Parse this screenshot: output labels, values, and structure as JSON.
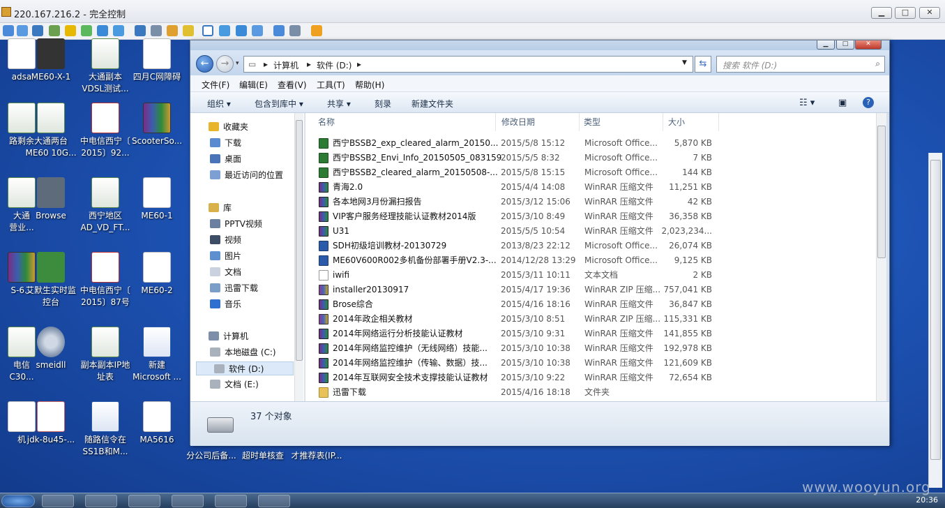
{
  "remote": {
    "title": "220.167.216.2 - 完全控制",
    "min": "▁",
    "max": "□",
    "close": "✕"
  },
  "desktop_icons": [
    {
      "label": "adsa",
      "kind": "file"
    },
    {
      "label": "ME60-X-1",
      "kind": "video"
    },
    {
      "label": "大通副本\nVDSL测试...",
      "kind": "xls"
    },
    {
      "label": "四月C网障碍",
      "kind": "file"
    },
    {
      "label": "路剩余",
      "kind": "xls"
    },
    {
      "label": "大通两台\nME60 10G...",
      "kind": "xls"
    },
    {
      "label": "中电信西宁〔\n2015〕92...",
      "kind": "pdf"
    },
    {
      "label": "ScooterSo...",
      "kind": "rar"
    },
    {
      "label": "大通\n营业...",
      "kind": "xls"
    },
    {
      "label": "Browse",
      "kind": "dish"
    },
    {
      "label": "西宁地区\nAD_VD_FT...",
      "kind": "xls"
    },
    {
      "label": "ME60-1",
      "kind": "file"
    },
    {
      "label": "S-6...",
      "kind": "rar"
    },
    {
      "label": "艾默生实时监\n控台",
      "kind": "net"
    },
    {
      "label": "中电信西宁〔\n2015〕87号",
      "kind": "pdf"
    },
    {
      "label": "ME60-2",
      "kind": "file"
    },
    {
      "label": "电信\nC30...",
      "kind": "xls"
    },
    {
      "label": "smeidll",
      "kind": "gear"
    },
    {
      "label": "副本副本IP地\n址表",
      "kind": "xls"
    },
    {
      "label": "新建\nMicrosoft ...",
      "kind": "word"
    },
    {
      "label": "机",
      "kind": "file"
    },
    {
      "label": "jdk-8u45-...",
      "kind": "java"
    },
    {
      "label": "随路信令在\nSS1B和M...",
      "kind": "word"
    },
    {
      "label": "MA5616",
      "kind": "file"
    }
  ],
  "desktop_behind_labels": [
    "分公司后备...",
    "超时单核查",
    "才推荐表(IP..."
  ],
  "explorer": {
    "address": [
      "计算机",
      "软件 (D:)"
    ],
    "search_placeholder": "搜索 软件 (D:)",
    "menus": [
      "文件(F)",
      "编辑(E)",
      "查看(V)",
      "工具(T)",
      "帮助(H)"
    ],
    "commands": [
      "组织 ▾",
      "包含到库中 ▾",
      "共享 ▾",
      "刻录",
      "新建文件夹"
    ],
    "nav": [
      {
        "label": "收藏夹",
        "head": true,
        "color": "#e8b52a"
      },
      {
        "label": "下载",
        "color": "#5a8ad0"
      },
      {
        "label": "桌面",
        "color": "#4a74b8"
      },
      {
        "label": "最近访问的位置",
        "color": "#7ca0d4"
      },
      {
        "label": "库",
        "head": true,
        "color": "#d9b14a"
      },
      {
        "label": "PPTV视频",
        "color": "#6b7fa0"
      },
      {
        "label": "视频",
        "color": "#3d4d66"
      },
      {
        "label": "图片",
        "color": "#5e8fcf"
      },
      {
        "label": "文档",
        "color": "#c9d2de"
      },
      {
        "label": "迅雷下载",
        "color": "#7a9ec8"
      },
      {
        "label": "音乐",
        "color": "#2f6fd0"
      },
      {
        "label": "计算机",
        "head": true,
        "color": "#7d8fa8"
      },
      {
        "label": "本地磁盘 (C:)",
        "color": "#a9b1bc"
      },
      {
        "label": "软件 (D:)",
        "color": "#a9b1bc",
        "selected": true
      },
      {
        "label": "文档 (E:)",
        "color": "#a9b1bc"
      }
    ],
    "columns": [
      "名称",
      "修改日期",
      "类型",
      "大小"
    ],
    "files": [
      {
        "name": "西宁BSSB2_exp_cleared_alarm_20150...",
        "date": "2015/5/8 15:12",
        "type": "Microsoft Office...",
        "size": "5,870 KB",
        "icon": "xls"
      },
      {
        "name": "西宁BSSB2_Envi_Info_20150505_083159",
        "date": "2015/5/5 8:32",
        "type": "Microsoft Office...",
        "size": "7 KB",
        "icon": "xls"
      },
      {
        "name": "西宁BSSB2_cleared_alarm_20150508-...",
        "date": "2015/5/8 15:15",
        "type": "Microsoft Office...",
        "size": "144 KB",
        "icon": "xls"
      },
      {
        "name": "青海2.0",
        "date": "2015/4/4 14:08",
        "type": "WinRAR 压缩文件",
        "size": "11,251 KB",
        "icon": "rar"
      },
      {
        "name": "各本地网3月份漏扫报告",
        "date": "2015/3/12 15:06",
        "type": "WinRAR 压缩文件",
        "size": "42 KB",
        "icon": "rar"
      },
      {
        "name": "VIP客户服务经理技能认证教材2014版",
        "date": "2015/3/10 8:49",
        "type": "WinRAR 压缩文件",
        "size": "36,358 KB",
        "icon": "rar"
      },
      {
        "name": "U31",
        "date": "2015/5/5 10:54",
        "type": "WinRAR 压缩文件",
        "size": "2,023,234...",
        "icon": "rar"
      },
      {
        "name": "SDH初级培训教材-20130729",
        "date": "2013/8/23 22:12",
        "type": "Microsoft Office...",
        "size": "26,074 KB",
        "icon": "doc"
      },
      {
        "name": "ME60V600R002多机备份部署手册V2.3-...",
        "date": "2014/12/28 13:29",
        "type": "Microsoft Office...",
        "size": "9,125 KB",
        "icon": "doc"
      },
      {
        "name": "iwifi",
        "date": "2015/3/11 10:11",
        "type": "文本文档",
        "size": "2 KB",
        "icon": "txt"
      },
      {
        "name": "installer20130917",
        "date": "2015/4/17 19:36",
        "type": "WinRAR ZIP 压缩...",
        "size": "757,041 KB",
        "icon": "zip"
      },
      {
        "name": "Brose综合",
        "date": "2015/4/16 18:16",
        "type": "WinRAR 压缩文件",
        "size": "36,847 KB",
        "icon": "rar"
      },
      {
        "name": "2014年政企相关教材",
        "date": "2015/3/10 8:51",
        "type": "WinRAR ZIP 压缩...",
        "size": "115,331 KB",
        "icon": "zip"
      },
      {
        "name": "2014年网络运行分析技能认证教材",
        "date": "2015/3/10 9:31",
        "type": "WinRAR 压缩文件",
        "size": "141,855 KB",
        "icon": "rar"
      },
      {
        "name": "2014年网络监控维护（无线网络）技能...",
        "date": "2015/3/10 10:38",
        "type": "WinRAR 压缩文件",
        "size": "192,978 KB",
        "icon": "rar"
      },
      {
        "name": "2014年网络监控维护（传输、数据）技...",
        "date": "2015/3/10 10:38",
        "type": "WinRAR 压缩文件",
        "size": "121,609 KB",
        "icon": "rar"
      },
      {
        "name": "2014年互联网安全技术支撑技能认证教材",
        "date": "2015/3/10 9:22",
        "type": "WinRAR 压缩文件",
        "size": "72,654 KB",
        "icon": "rar"
      },
      {
        "name": "迅雷下载",
        "date": "2015/4/16 18:18",
        "type": "文件夹",
        "size": "",
        "icon": "folder"
      }
    ],
    "status": "37 个对象"
  },
  "clock": "20:36",
  "watermark": "www.wooyun.org"
}
